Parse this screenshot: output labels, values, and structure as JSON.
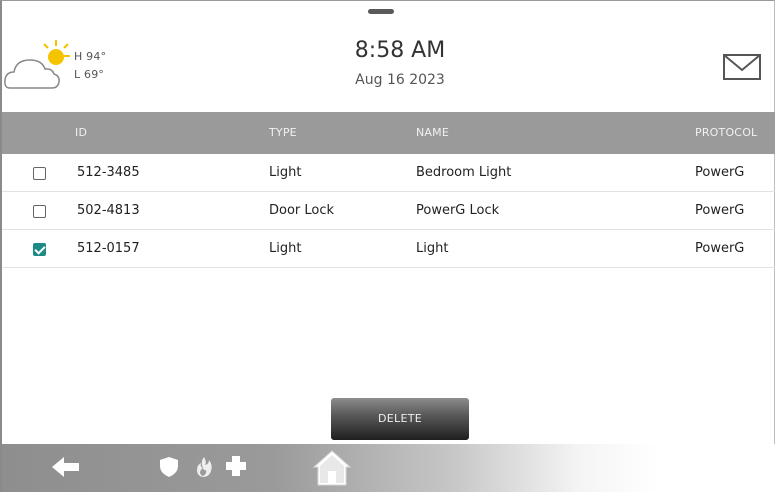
{
  "weather": {
    "high": "H 94°",
    "low": "L 69°",
    "icon": "partly-sunny-icon"
  },
  "clock": {
    "time": "8:58 AM",
    "date": "Aug 16 2023"
  },
  "table": {
    "columns": {
      "id": "ID",
      "type": "TYPE",
      "name": "NAME",
      "protocol": "PROTOCOL"
    },
    "rows": [
      {
        "checked": false,
        "id": "512-3485",
        "type": "Light",
        "name": "Bedroom Light",
        "protocol": "PowerG"
      },
      {
        "checked": false,
        "id": "502-4813",
        "type": "Door Lock",
        "name": "PowerG Lock",
        "protocol": "PowerG"
      },
      {
        "checked": true,
        "id": "512-0157",
        "type": "Light",
        "name": "Light",
        "protocol": "PowerG"
      }
    ]
  },
  "actions": {
    "delete_label": "DELETE"
  },
  "nav": {
    "icons": [
      "back-arrow-icon",
      "shield-icon",
      "fire-icon",
      "medical-plus-icon",
      "home-icon"
    ]
  },
  "colors": {
    "checkbox_checked": "#1e8a86",
    "header_bar": "#9a9a9a"
  }
}
